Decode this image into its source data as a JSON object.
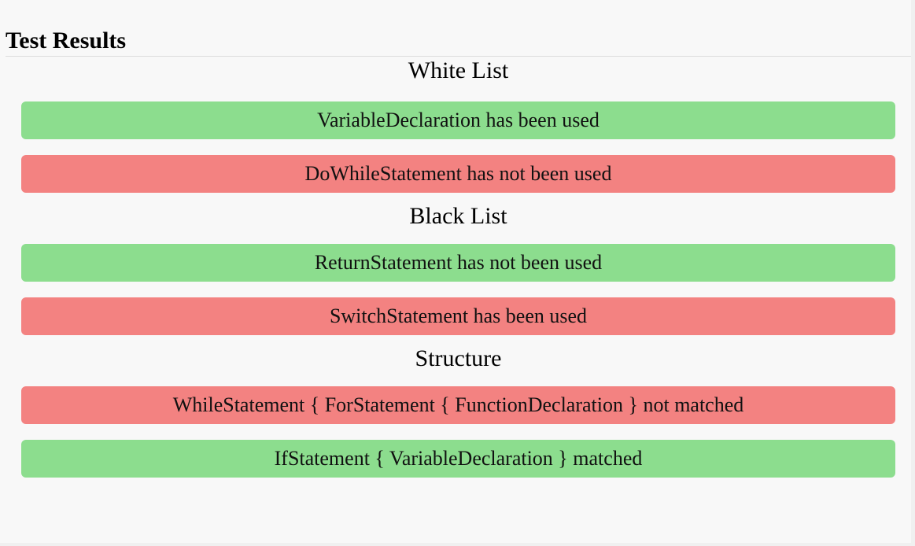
{
  "title": "Test Results",
  "colors": {
    "pass": "#8cdd8e",
    "fail": "#f38281"
  },
  "sections": [
    {
      "heading": "White List",
      "results": [
        {
          "text": "VariableDeclaration has been used",
          "status": "pass"
        },
        {
          "text": "DoWhileStatement has not been used",
          "status": "fail"
        }
      ]
    },
    {
      "heading": "Black List",
      "results": [
        {
          "text": "ReturnStatement has not been used",
          "status": "pass"
        },
        {
          "text": "SwitchStatement has been used",
          "status": "fail"
        }
      ]
    },
    {
      "heading": "Structure",
      "results": [
        {
          "text": "WhileStatement { ForStatement { FunctionDeclaration } not matched",
          "status": "fail"
        },
        {
          "text": "IfStatement { VariableDeclaration } matched",
          "status": "pass"
        }
      ]
    }
  ]
}
